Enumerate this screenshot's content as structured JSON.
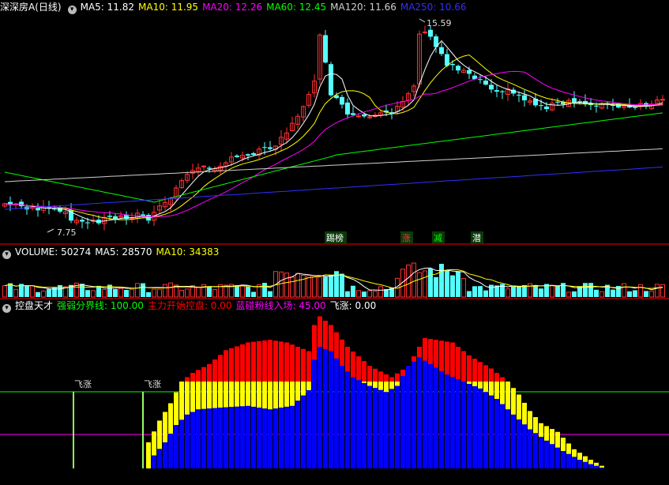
{
  "price_legend": {
    "stock_name": "深深房A",
    "period": "(日线)",
    "ma": [
      {
        "label": "MA5: 11.82",
        "color": "#ffffff"
      },
      {
        "label": "MA10: 11.95",
        "color": "#ffff00"
      },
      {
        "label": "MA20: 12.26",
        "color": "#ff00ff"
      },
      {
        "label": "MA60: 12.45",
        "color": "#00ff00"
      },
      {
        "label": "MA120: 11.66",
        "color": "#d0d0d0"
      },
      {
        "label": "MA250: 10.66",
        "color": "#3030ff"
      }
    ]
  },
  "price_annotations": {
    "high": "15.59",
    "low": "7.75",
    "signals": [
      {
        "text": "踢榜",
        "color": "#ffffff"
      },
      {
        "text": "涨",
        "color": "#ff3030"
      },
      {
        "text": "减",
        "color": "#00ff00"
      },
      {
        "text": "潜",
        "color": "#ffffff"
      }
    ]
  },
  "volume_legend": {
    "title": "VOLUME: 50274",
    "ma5": "MA5: 28570",
    "ma10": "MA10: 34383"
  },
  "indicator_legend": {
    "title": "控盘天才",
    "items": [
      {
        "label": "强弱分界线: 100.00",
        "color": "#00ff00"
      },
      {
        "label": "主力开始控盘: 0.00",
        "color": "#ff0000"
      },
      {
        "label": "蓝碰粉线入场: 45.00",
        "color": "#ff00ff"
      },
      {
        "label": "飞涨: 0.00",
        "color": "#ffffff"
      }
    ],
    "markers": [
      "飞涨",
      "飞涨"
    ]
  },
  "colors": {
    "up": "#ff3232",
    "down": "#54ffff",
    "bar_blue": "#0000ff",
    "bar_yellow": "#ffff00",
    "bar_red": "#ff0000",
    "separator": "#7a0000",
    "strong_line": "#00ff00",
    "entry_line": "#ff00ff"
  },
  "icons": [
    "dropdown-circle-icon"
  ]
}
